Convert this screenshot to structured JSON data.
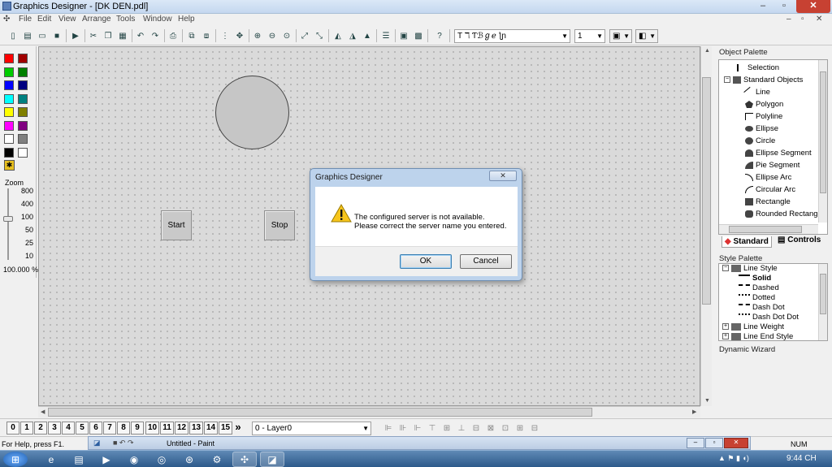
{
  "window": {
    "title": "Graphics Designer - [DK DEN.pdl]"
  },
  "menu": [
    "File",
    "Edit",
    "View",
    "Arrange",
    "Tools",
    "Window",
    "Help"
  ],
  "toolbar": {
    "font_name": "ℸ Ƭℬℊℯ ƪɲ",
    "line_width": "1"
  },
  "colors": {
    "palette": [
      "#ff0000",
      "#a00000",
      "#00cc00",
      "#008000",
      "#0000ff",
      "#000080",
      "#00ffff",
      "#008080",
      "#ffff00",
      "#808000",
      "#ff00ff",
      "#800080",
      "#ffffff",
      "#808080",
      "#000000",
      "#ffffff"
    ],
    "accent": "#3a6ea5"
  },
  "zoom": {
    "label": "Zoom",
    "levels": [
      "800",
      "400",
      "100",
      "50",
      "25",
      "10"
    ],
    "value": "100.000",
    "unit": "%"
  },
  "canvas": {
    "start_label": "Start",
    "stop_label": "Stop"
  },
  "object_palette": {
    "header": "Object Palette",
    "selection": "Selection",
    "group": "Standard Objects",
    "items": [
      "Line",
      "Polygon",
      "Polyline",
      "Ellipse",
      "Circle",
      "Ellipse Segment",
      "Pie Segment",
      "Ellipse Arc",
      "Circular Arc",
      "Rectangle",
      "Rounded Rectang"
    ],
    "tabs": [
      "Standard",
      "Controls"
    ]
  },
  "style_palette": {
    "header": "Style Palette",
    "group": "Line Style",
    "items": [
      "Solid",
      "Dashed",
      "Dotted",
      "Dash Dot",
      "Dash Dot Dot"
    ],
    "more": [
      "Line Weight",
      "Line End Style"
    ]
  },
  "dynamic_wizard": {
    "header": "Dynamic Wizard"
  },
  "layers": {
    "numbers": [
      "0",
      "1",
      "2",
      "3",
      "4",
      "5",
      "6",
      "7",
      "8",
      "9",
      "10",
      "11",
      "12",
      "13",
      "14",
      "15"
    ],
    "more": "»",
    "selected": "0 - Layer0"
  },
  "statusbar": {
    "help": "For Help, press F1.",
    "num": "NUM"
  },
  "paint_window": {
    "title": "Untitled - Paint"
  },
  "taskbar": {
    "time": "9:44 CH"
  },
  "dialog": {
    "title": "Graphics Designer",
    "line1": "The configured server is not available.",
    "line2": "Please correct the server name you entered.",
    "ok": "OK",
    "cancel": "Cancel"
  }
}
